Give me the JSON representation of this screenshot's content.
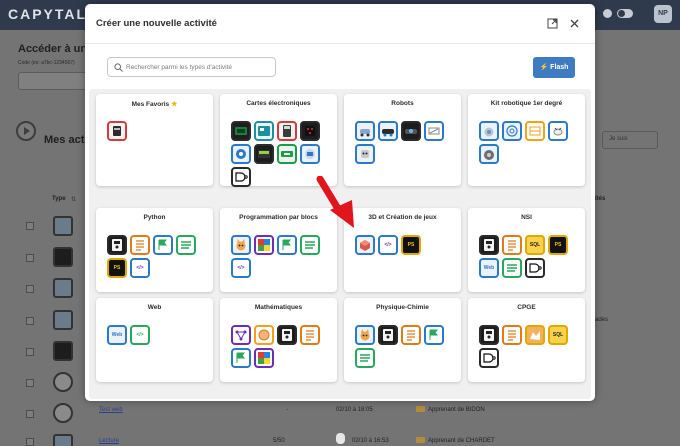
{
  "app": {
    "brand": "CAPYTALE",
    "avatar": "NP"
  },
  "background": {
    "page_title": "Accéder à une",
    "code_hint": "Code (ex: a7bc-1234567)",
    "section_title": "Mes acti",
    "sort_select": "Je suis",
    "col_type": "Type",
    "col_type_icon": "⇅",
    "col_activites": "ités",
    "col_extra": "ades",
    "rows": [
      {
        "link": "Lecture",
        "dash": "",
        "date": "",
        "owner": ""
      },
      {
        "link": "Lecture",
        "dash": "",
        "date": "",
        "owner": ""
      },
      {
        "link": "Lecture",
        "dash": "",
        "date": "",
        "owner": ""
      },
      {
        "link": "Test web",
        "dash": "-",
        "date": "02/10 à 18:05",
        "owner": "Apprenant de BIDON"
      },
      {
        "link": "Lecture",
        "dash": "5/50",
        "date": "02/10 à 16:53",
        "owner": "Apprenant de CHARDET"
      }
    ]
  },
  "modal": {
    "title": "Créer une nouvelle activité",
    "search_placeholder": "Rechercher parmi les types d'activité",
    "flash_label": "⚡ Flash",
    "favorite_star": "★",
    "categories": [
      {
        "title": "Mes Favoris",
        "icons": [
          "arduino-board"
        ]
      },
      {
        "title": "Cartes électroniques",
        "icons": [
          "microbit",
          "arduino-uno",
          "calculator",
          "microbit-matrix",
          "esp32",
          "lcd-board",
          "pico-board",
          "raspberry-board",
          "logic-gate"
        ]
      },
      {
        "title": "Robots",
        "icons": [
          "robot-rover",
          "robot-car",
          "robot-tank",
          "robot-sketch",
          "robot-head"
        ]
      },
      {
        "title": "Kit robotique 1er degré",
        "icons": [
          "robot-ball",
          "spiral-bot",
          "tile-pad",
          "robot-bee",
          "robot-vacuum"
        ]
      },
      {
        "title": "Python",
        "icons": [
          "notebook",
          "code-list",
          "console-flag",
          "console-lines",
          "pixel-game",
          "python-editor"
        ]
      },
      {
        "title": "Programmation par blocs",
        "icons": [
          "scratch-cat",
          "block-grid",
          "console-flag",
          "console-lines",
          "python-editor"
        ]
      },
      {
        "title": "3D et Création de jeux",
        "icons": [
          "box-3d",
          "python-editor",
          "pixel-game"
        ]
      },
      {
        "title": "NSI",
        "icons": [
          "notebook",
          "code-list",
          "sql-db",
          "pixel-game",
          "web-globe",
          "console-lines",
          "logic-gate"
        ]
      },
      {
        "title": "Web",
        "icons": [
          "web-globe",
          "code-editor"
        ]
      },
      {
        "title": "Mathématiques",
        "icons": [
          "graph-network",
          "geogebra",
          "notebook",
          "code-list",
          "console-flag",
          "block-grid"
        ]
      },
      {
        "title": "Physique-Chimie",
        "icons": [
          "scratch-cat",
          "notebook",
          "code-list",
          "console-flag",
          "console-lines"
        ]
      },
      {
        "title": "CPGE",
        "icons": [
          "notebook",
          "code-list",
          "ocaml",
          "sql-db",
          "logic-gate"
        ]
      }
    ]
  },
  "tile_texts": {
    "sql": "SQL",
    "ps": "PS",
    "web": "Web",
    "code": "</>"
  },
  "colors": {
    "flash": "#3f7bc0",
    "topbar": "#2f3a4c",
    "arrow": "#e0161c"
  }
}
